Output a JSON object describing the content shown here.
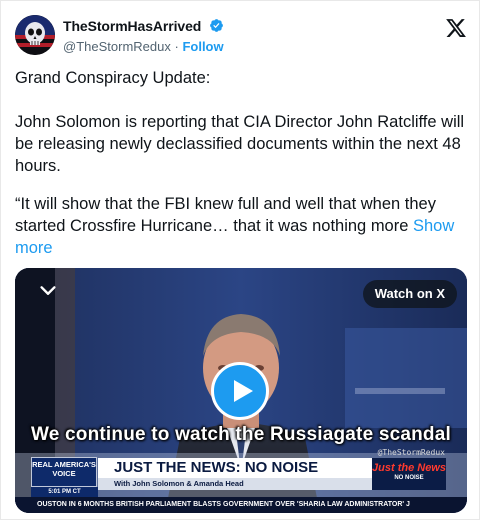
{
  "tweet": {
    "display_name": "TheStormHasArrived",
    "handle": "@TheStormRedux",
    "separator": "·",
    "follow_label": "Follow",
    "paragraphs": [
      "Grand Conspiracy Update:",
      "John Solomon is reporting that CIA Director John Ratcliffe will be releasing newly declassified documents within the next 48 hours.",
      "“It will show that the FBI knew full and well that when they started Crossfire Hurricane… that it was nothing more"
    ],
    "show_more_label": "Show more"
  },
  "video": {
    "watch_on_label": "Watch on X",
    "caption": "We continue to watch the Russiagate scandal",
    "watermark": "@TheStormRedux",
    "chyron": {
      "logo_text": "REAL AMERICA'S VOICE",
      "time": "5:01 PM CT",
      "headline": "JUST THE NEWS: NO NOISE",
      "subline": "With John Solomon & Amanda Head",
      "brand": "Just the News",
      "brand_tag": "NO NOISE",
      "ticker": "OUSTON IN 6 MONTHS     BRITISH PARLIAMENT BLASTS GOVERNMENT OVER 'SHARIA LAW ADMINISTRATOR' J"
    }
  },
  "colors": {
    "accent": "#1d9bf0",
    "text": "#0f1419",
    "secondary": "#536471"
  },
  "icons": {
    "verified": "verified-badge-icon",
    "x_logo": "x-logo-icon",
    "play": "play-icon",
    "collapse": "chevron-down-icon"
  }
}
